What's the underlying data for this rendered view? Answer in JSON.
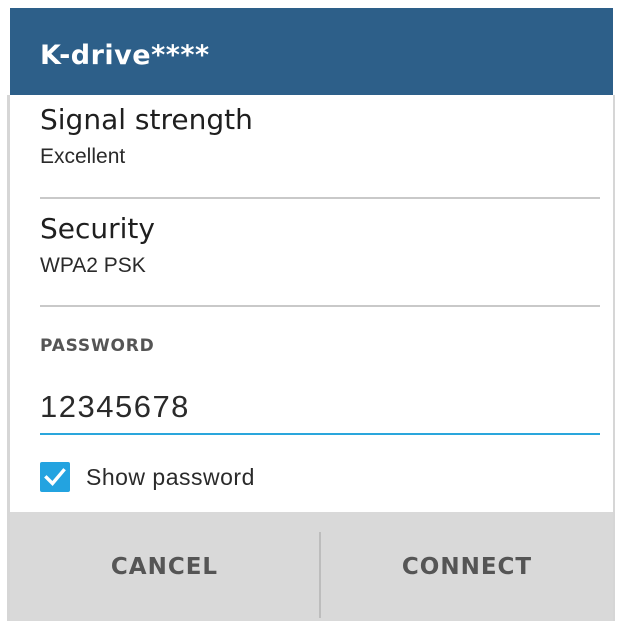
{
  "dialog": {
    "title": "K-drive****",
    "colors": {
      "header_bg": "#2d5f89",
      "accent": "#23a3e0",
      "button_bar_bg": "#d9d9d9"
    }
  },
  "signal": {
    "label": "Signal strength",
    "value": "Excellent"
  },
  "security": {
    "label": "Security",
    "value": "WPA2 PSK"
  },
  "password": {
    "header": "PASSWORD",
    "value": "12345678"
  },
  "show_password": {
    "label": "Show password",
    "checked": true,
    "icon": "checkmark-icon"
  },
  "buttons": {
    "cancel": "CANCEL",
    "connect": "CONNECT"
  }
}
